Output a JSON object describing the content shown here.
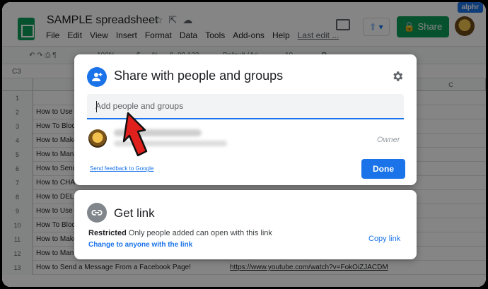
{
  "app": {
    "title": "SAMPLE spreadsheet",
    "menu": [
      "File",
      "Edit",
      "View",
      "Insert",
      "Format",
      "Data",
      "Tools",
      "Add-ons",
      "Help"
    ],
    "last_edit": "Last edit ...",
    "share_button": "Share",
    "watermark": "alphr"
  },
  "toolbar": {
    "zoom": "100%",
    "currency": "$",
    "percent": "%",
    "decimals": ".0  .00  123",
    "font": "Default (Ari...",
    "font_size": "10",
    "bold": "B"
  },
  "formula_bar": {
    "cell_ref": "C3"
  },
  "grid": {
    "col_c": "C",
    "rows": [
      {
        "num": "1",
        "a": "",
        "b": ""
      },
      {
        "num": "2",
        "a": "How to Use",
        "b": ""
      },
      {
        "num": "3",
        "a": "How To Bloc",
        "b": ""
      },
      {
        "num": "4",
        "a": "How to Make",
        "b": ""
      },
      {
        "num": "5",
        "a": "How to Mana",
        "b": ""
      },
      {
        "num": "6",
        "a": "How to Send",
        "b": ""
      },
      {
        "num": "7",
        "a": "How to CHA",
        "b": ""
      },
      {
        "num": "8",
        "a": "How to DEL",
        "b": ""
      },
      {
        "num": "9",
        "a": "How to Use",
        "b": ""
      },
      {
        "num": "10",
        "a": "How To Bloc",
        "b": ""
      },
      {
        "num": "11",
        "a": "How to Make",
        "b": ""
      },
      {
        "num": "12",
        "a": "How to Man",
        "b": ""
      },
      {
        "num": "13",
        "a": "How to Send a Message From a Facebook Page!",
        "b": "https://www.youtube.com/watch?v=FokOiZJACDM"
      }
    ]
  },
  "share_dialog": {
    "title": "Share with people and groups",
    "input_placeholder": "Add people and groups",
    "owner_role": "Owner",
    "feedback_link": "Send feedback to Google",
    "done_button": "Done"
  },
  "link_dialog": {
    "title": "Get link",
    "restricted_label": "Restricted",
    "restricted_text": " Only people added can open with this link",
    "change_link": "Change to anyone with the link",
    "copy_link": "Copy link"
  }
}
